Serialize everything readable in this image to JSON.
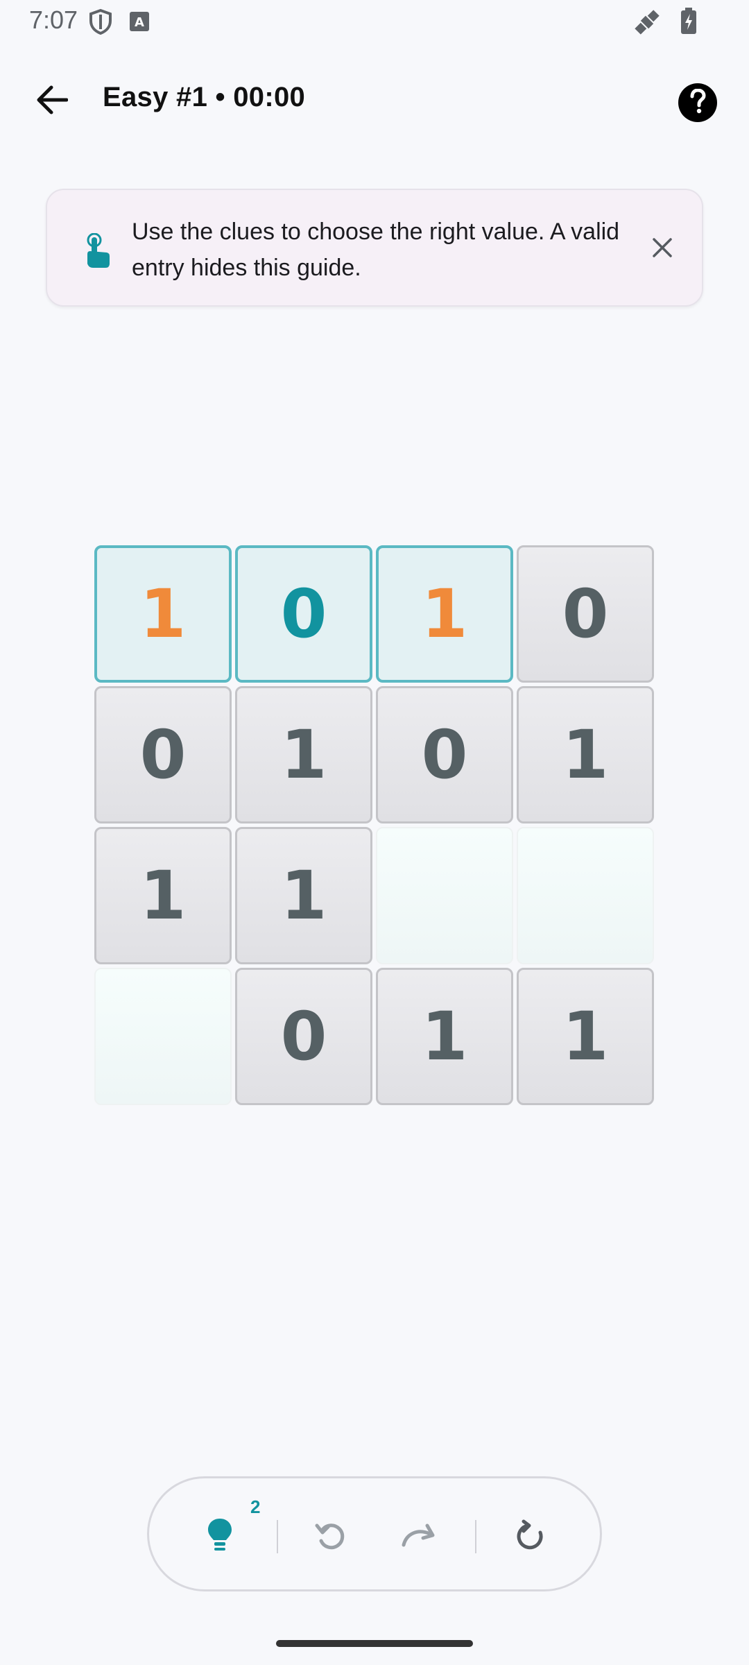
{
  "status_bar": {
    "time": "7:07",
    "icons": [
      "shield-icon",
      "keyboard-icon",
      "satellite-icon",
      "battery-charging-icon"
    ]
  },
  "header": {
    "title": "Easy #1 • 00:00",
    "back_icon": "arrow-back-icon",
    "help_icon": "help-circle-icon"
  },
  "guide": {
    "icon": "touch-hand-icon",
    "text": "Use the clues to choose the right value. A valid entry hides this guide.",
    "close_icon": "close-icon"
  },
  "board": {
    "size": 4,
    "cells": [
      {
        "value": "1",
        "state": "highlighted",
        "color": "#f08a3a"
      },
      {
        "value": "0",
        "state": "highlighted",
        "color": "#12939f"
      },
      {
        "value": "1",
        "state": "highlighted",
        "color": "#f08a3a"
      },
      {
        "value": "0",
        "state": "locked",
        "color": "#556064"
      },
      {
        "value": "0",
        "state": "locked",
        "color": "#556064"
      },
      {
        "value": "1",
        "state": "locked",
        "color": "#556064"
      },
      {
        "value": "0",
        "state": "locked",
        "color": "#556064"
      },
      {
        "value": "1",
        "state": "locked",
        "color": "#556064"
      },
      {
        "value": "1",
        "state": "locked",
        "color": "#556064"
      },
      {
        "value": "1",
        "state": "locked",
        "color": "#556064"
      },
      {
        "value": "",
        "state": "empty",
        "color": ""
      },
      {
        "value": "",
        "state": "empty",
        "color": ""
      },
      {
        "value": "",
        "state": "empty",
        "color": ""
      },
      {
        "value": "0",
        "state": "locked",
        "color": "#556064"
      },
      {
        "value": "1",
        "state": "locked",
        "color": "#556064"
      },
      {
        "value": "1",
        "state": "locked",
        "color": "#556064"
      }
    ]
  },
  "toolbar": {
    "hint_icon": "lightbulb-icon",
    "hint_count": "2",
    "undo_icon": "undo-icon",
    "redo_icon": "redo-icon",
    "restart_icon": "restart-icon"
  },
  "colors": {
    "accent": "#12939f",
    "orange": "#f08a3a",
    "locked_text": "#556064"
  }
}
